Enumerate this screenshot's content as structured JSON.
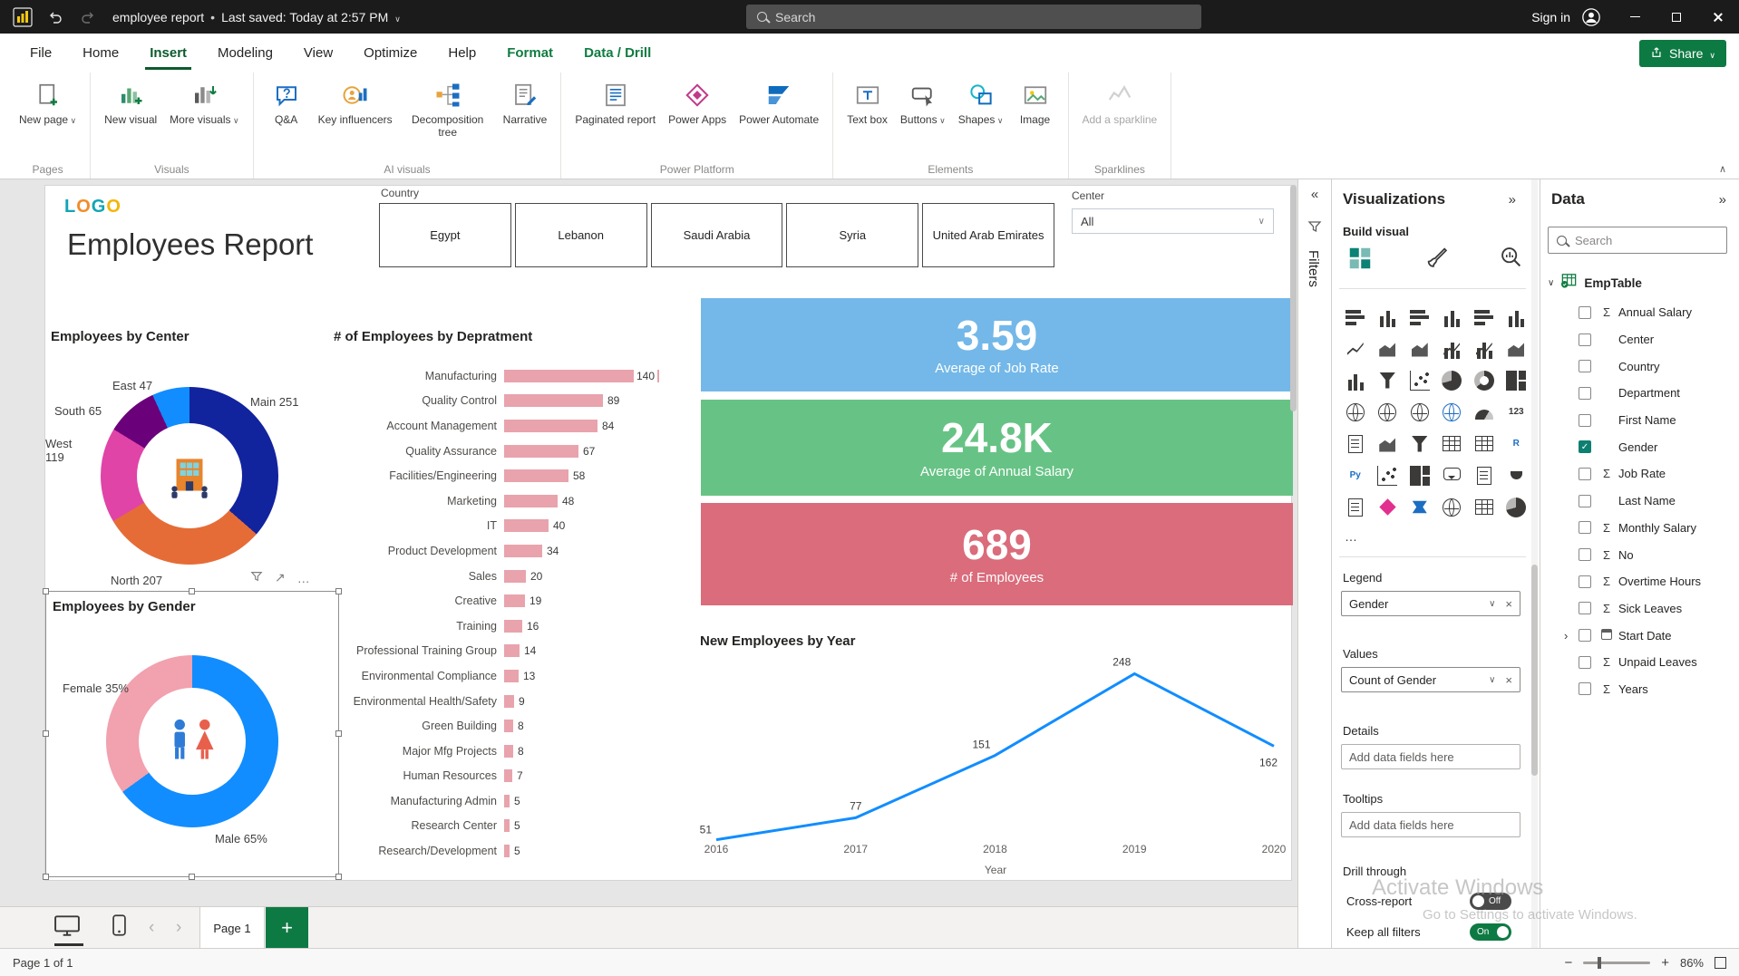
{
  "titlebar": {
    "document_title": "employee report",
    "saved_status": "Last saved: Today at 2:57 PM",
    "search_placeholder": "Search",
    "sign_in_label": "Sign in"
  },
  "menubar": {
    "items": [
      {
        "label": "File"
      },
      {
        "label": "Home"
      },
      {
        "label": "Insert",
        "active": true
      },
      {
        "label": "Modeling"
      },
      {
        "label": "View"
      },
      {
        "label": "Optimize"
      },
      {
        "label": "Help"
      },
      {
        "label": "Format",
        "accent": true
      },
      {
        "label": "Data / Drill",
        "accent": true
      }
    ],
    "share_label": "Share"
  },
  "ribbon": {
    "groups": [
      {
        "label": "Pages",
        "buttons": [
          {
            "label": "New page",
            "icon": "new-page-icon",
            "dropdown": true
          }
        ]
      },
      {
        "label": "Visuals",
        "buttons": [
          {
            "label": "New visual",
            "icon": "new-visual-icon"
          },
          {
            "label": "More visuals",
            "icon": "more-visuals-icon",
            "dropdown": true
          }
        ]
      },
      {
        "label": "AI visuals",
        "buttons": [
          {
            "label": "Q&A",
            "icon": "qa-icon"
          },
          {
            "label": "Key influencers",
            "icon": "key-influencers-icon"
          },
          {
            "label": "Decomposition tree",
            "icon": "decomposition-tree-icon"
          },
          {
            "label": "Narrative",
            "icon": "narrative-icon"
          }
        ]
      },
      {
        "label": "Power Platform",
        "buttons": [
          {
            "label": "Paginated report",
            "icon": "paginated-report-icon"
          },
          {
            "label": "Power Apps",
            "icon": "power-apps-icon"
          },
          {
            "label": "Power Automate",
            "icon": "power-automate-icon"
          }
        ]
      },
      {
        "label": "Elements",
        "buttons": [
          {
            "label": "Text box",
            "icon": "text-box-icon"
          },
          {
            "label": "Buttons",
            "icon": "buttons-icon",
            "dropdown": true
          },
          {
            "label": "Shapes",
            "icon": "shapes-icon",
            "dropdown": true
          },
          {
            "label": "Image",
            "icon": "image-icon"
          }
        ]
      },
      {
        "label": "Sparklines",
        "buttons": [
          {
            "label": "Add a sparkline",
            "icon": "sparkline-icon",
            "disabled": true
          }
        ]
      }
    ]
  },
  "report": {
    "logo_text": "LOGO",
    "title": "Employees Report",
    "country_slicer": {
      "label": "Country",
      "options": [
        "Egypt",
        "Lebanon",
        "Saudi Arabia",
        "Syria",
        "United Arab Emirates"
      ]
    },
    "center_filter": {
      "label": "Center",
      "value": "All"
    },
    "center_donut": {
      "title": "Employees by Center",
      "slices": [
        {
          "label": "Main",
          "value": 251,
          "color": "#12239E"
        },
        {
          "label": "North",
          "value": 207,
          "color": "#E66C37"
        },
        {
          "label": "West",
          "value": 119,
          "color": "#E044A7"
        },
        {
          "label": "South",
          "value": 65,
          "color": "#6B007B"
        },
        {
          "label": "East",
          "value": 47,
          "color": "#118DFF"
        }
      ]
    },
    "dept_bar": {
      "title": "# of Employees by Depratment",
      "color": "#E8A3AC",
      "items": [
        {
          "label": "Manufacturing",
          "value": 140
        },
        {
          "label": "Quality Control",
          "value": 89
        },
        {
          "label": "Account Management",
          "value": 84
        },
        {
          "label": "Quality Assurance",
          "value": 67
        },
        {
          "label": "Facilities/Engineering",
          "value": 58
        },
        {
          "label": "Marketing",
          "value": 48
        },
        {
          "label": "IT",
          "value": 40
        },
        {
          "label": "Product Development",
          "value": 34
        },
        {
          "label": "Sales",
          "value": 20
        },
        {
          "label": "Creative",
          "value": 19
        },
        {
          "label": "Training",
          "value": 16
        },
        {
          "label": "Professional Training Group",
          "value": 14
        },
        {
          "label": "Environmental Compliance",
          "value": 13
        },
        {
          "label": "Environmental Health/Safety",
          "value": 9
        },
        {
          "label": "Green Building",
          "value": 8
        },
        {
          "label": "Major Mfg Projects",
          "value": 8
        },
        {
          "label": "Human Resources",
          "value": 7
        },
        {
          "label": "Manufacturing Admin",
          "value": 5
        },
        {
          "label": "Research Center",
          "value": 5
        },
        {
          "label": "Research/Development",
          "value": 5
        }
      ]
    },
    "kpi_cards": [
      {
        "value": "3.59",
        "label": "Average of Job Rate",
        "color": "#73B8E8"
      },
      {
        "value": "24.8K",
        "label": "Average of Annual Salary",
        "color": "#67C385"
      },
      {
        "value": "689",
        "label": "# of Employees",
        "color": "#DA6C7B"
      }
    ],
    "year_line": {
      "title": "New Employees by Year",
      "xlabel": "Year",
      "color": "#118DFF",
      "points": [
        {
          "year": "2016",
          "value": 51
        },
        {
          "year": "2017",
          "value": 77
        },
        {
          "year": "2018",
          "value": 151
        },
        {
          "year": "2019",
          "value": 248
        },
        {
          "year": "2020",
          "value": 162
        }
      ]
    },
    "gender_donut": {
      "title": "Employees by Gender",
      "slices": [
        {
          "label": "Male",
          "pct": 65,
          "color": "#118DFF"
        },
        {
          "label": "Female",
          "pct": 35,
          "color": "#F2A1AE"
        }
      ]
    }
  },
  "filters_panel": {
    "title": "Filters"
  },
  "visualizations_panel": {
    "title": "Visualizations",
    "build_label": "Build visual",
    "ellipsis": "…",
    "icon_grid": [
      {
        "name": "stacked-bar-chart",
        "kind": "hbars"
      },
      {
        "name": "stacked-column-chart",
        "kind": "vbars"
      },
      {
        "name": "clustered-bar-chart",
        "kind": "hbars"
      },
      {
        "name": "clustered-column-chart",
        "kind": "vbars"
      },
      {
        "name": "100-stacked-bar-chart",
        "kind": "hbars"
      },
      {
        "name": "100-stacked-column-chart",
        "kind": "vbars"
      },
      {
        "name": "line-chart",
        "kind": "line"
      },
      {
        "name": "area-chart",
        "kind": "area"
      },
      {
        "name": "stacked-area-chart",
        "kind": "area"
      },
      {
        "name": "line-and-stacked-column-chart",
        "kind": "combo"
      },
      {
        "name": "line-and-clustered-column-chart",
        "kind": "combo"
      },
      {
        "name": "ribbon-chart",
        "kind": "area"
      },
      {
        "name": "waterfall-chart",
        "kind": "vbars"
      },
      {
        "name": "funnel-chart",
        "kind": "funnel"
      },
      {
        "name": "scatter-chart",
        "kind": "scatter"
      },
      {
        "name": "pie-chart",
        "kind": "pie"
      },
      {
        "name": "donut-chart",
        "kind": "donut"
      },
      {
        "name": "treemap",
        "kind": "treemap"
      },
      {
        "name": "map",
        "kind": "map"
      },
      {
        "name": "filled-map",
        "kind": "map"
      },
      {
        "name": "shape-map",
        "kind": "map"
      },
      {
        "name": "azure-map",
        "kind": "map",
        "color": "#1B6EC2"
      },
      {
        "name": "gauge",
        "kind": "gauge"
      },
      {
        "name": "card",
        "kind": "text",
        "text": "123"
      },
      {
        "name": "multi-row-card",
        "kind": "doc"
      },
      {
        "name": "kpi",
        "kind": "area"
      },
      {
        "name": "slicer",
        "kind": "funnel"
      },
      {
        "name": "table",
        "kind": "table"
      },
      {
        "name": "matrix",
        "kind": "table"
      },
      {
        "name": "r-script-visual",
        "kind": "text",
        "text": "R",
        "color": "#1B6EC2"
      },
      {
        "name": "python-visual",
        "kind": "text",
        "text": "Py",
        "color": "#1B6EC2"
      },
      {
        "name": "key-influencers",
        "kind": "scatter"
      },
      {
        "name": "decomposition-tree",
        "kind": "treemap"
      },
      {
        "name": "qa-visual",
        "kind": "bubble"
      },
      {
        "name": "smart-narrative",
        "kind": "doc"
      },
      {
        "name": "goals",
        "kind": "cup"
      },
      {
        "name": "paginated-report",
        "kind": "doc"
      },
      {
        "name": "power-apps",
        "kind": "diamond",
        "color": "#E2308E"
      },
      {
        "name": "power-automate",
        "kind": "flow",
        "color": "#1B6EC2"
      },
      {
        "name": "arcgis-map",
        "kind": "map"
      },
      {
        "name": "tile-slicer",
        "kind": "table"
      },
      {
        "name": "custom-visual",
        "kind": "pie"
      }
    ],
    "legend": {
      "label": "Legend",
      "value": "Gender"
    },
    "values": {
      "label": "Values",
      "value": "Count of Gender"
    },
    "details": {
      "label": "Details",
      "placeholder": "Add data fields here"
    },
    "tooltips": {
      "label": "Tooltips",
      "placeholder": "Add data fields here"
    },
    "drill_through": {
      "label": "Drill through",
      "cross_report": {
        "label": "Cross-report",
        "state": "Off"
      },
      "keep_all_filters": {
        "label": "Keep all filters",
        "state": "On"
      }
    }
  },
  "data_panel": {
    "title": "Data",
    "search_placeholder": "Search",
    "table": {
      "name": "EmpTable"
    },
    "fields": [
      {
        "label": "Annual Salary",
        "sigma": true
      },
      {
        "label": "Center"
      },
      {
        "label": "Country"
      },
      {
        "label": "Department"
      },
      {
        "label": "First Name"
      },
      {
        "label": "Gender",
        "checked": true
      },
      {
        "label": "Job Rate",
        "sigma": true
      },
      {
        "label": "Last Name"
      },
      {
        "label": "Monthly Salary",
        "sigma": true
      },
      {
        "label": "No",
        "sigma": true
      },
      {
        "label": "Overtime Hours",
        "sigma": true
      },
      {
        "label": "Sick Leaves",
        "sigma": true
      },
      {
        "label": "Start Date",
        "expandable": true,
        "calendar": true
      },
      {
        "label": "Unpaid Leaves",
        "sigma": true
      },
      {
        "label": "Years",
        "sigma": true
      }
    ]
  },
  "page_tabs": {
    "label": "Page 1"
  },
  "status_bar": {
    "page_indicator": "Page 1 of 1",
    "zoom": "86%"
  },
  "watermark": {
    "line1": "Activate Windows",
    "line2": "Go to Settings to activate Windows."
  }
}
